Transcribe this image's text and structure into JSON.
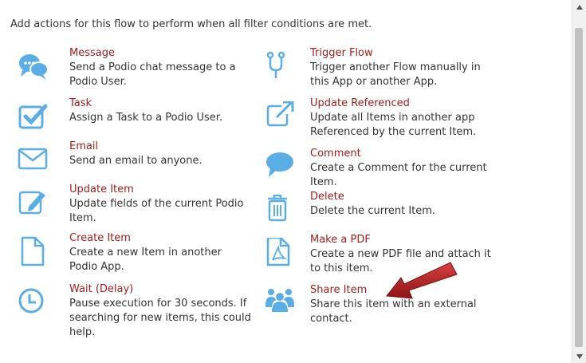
{
  "intro_text": "Add actions for this flow to perform when all filter conditions are met.",
  "colors": {
    "icon": "#5aaee6",
    "title": "#9b1b1b",
    "arrow": "#b02020"
  },
  "actions_left": [
    {
      "icon": "chat-bubbles-icon",
      "title": "Message",
      "desc": "Send a Podio chat message to a Podio User."
    },
    {
      "icon": "checkbox-icon",
      "title": "Task",
      "desc": "Assign a Task to a Podio User."
    },
    {
      "icon": "envelope-icon",
      "title": "Email",
      "desc": "Send an email to anyone."
    },
    {
      "icon": "pencil-edit-icon",
      "title": "Update Item",
      "desc": "Update fields of the current Podio Item."
    },
    {
      "icon": "document-icon",
      "title": "Create Item",
      "desc": "Create a new Item in another Podio App."
    },
    {
      "icon": "clock-icon",
      "title": "Wait (Delay)",
      "desc": "Pause execution for 30 seconds. If searching for new items, this could help."
    }
  ],
  "actions_right": [
    {
      "icon": "branch-icon",
      "title": "Trigger Flow",
      "desc": "Trigger another Flow manually in this App or another App."
    },
    {
      "icon": "external-link-icon",
      "title": "Update Referenced",
      "desc": "Update all Items in another app Referenced by the current Item."
    },
    {
      "icon": "speech-bubble-icon",
      "title": "Comment",
      "desc": "Create a Comment for the current Item."
    },
    {
      "icon": "trash-icon",
      "title": "Delete",
      "desc": "Delete the current Item."
    },
    {
      "icon": "pdf-icon",
      "title": "Make a PDF",
      "desc": "Create a new PDF file and attach it to this item."
    },
    {
      "icon": "people-icon",
      "title": "Share Item",
      "desc": "Share this item with an external contact."
    }
  ]
}
